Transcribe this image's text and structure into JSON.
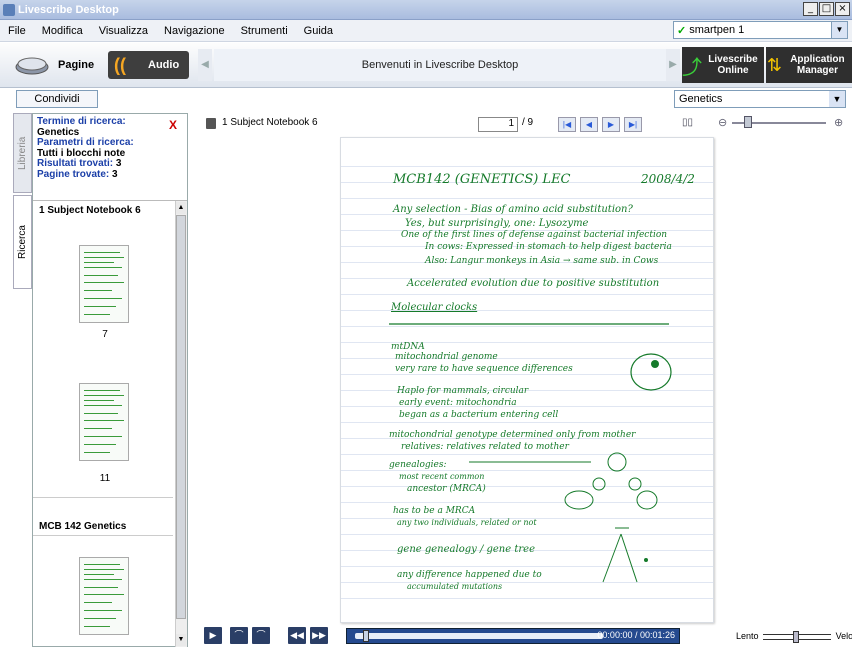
{
  "window": {
    "title": "Livescribe Desktop"
  },
  "menu": {
    "items": [
      "File",
      "Modifica",
      "Visualizza",
      "Navigazione",
      "Strumenti",
      "Guida"
    ]
  },
  "pen": {
    "selected": "smartpen 1"
  },
  "toolbar": {
    "pages_label": "Pagine",
    "audio_label": "Audio",
    "welcome": "Benvenuti in Livescribe Desktop",
    "online_label": "Livescribe Online",
    "appmgr_label": "Application Manager"
  },
  "share_label": "Condividi",
  "notebook_filter": "Genetics",
  "tabs": {
    "library": "Libreria",
    "search": "Ricerca"
  },
  "search": {
    "term_label": "Termine di ricerca:",
    "term_value": "Genetics",
    "params_label": "Parametri di ricerca:",
    "params_value": "Tutti i blocchi note",
    "results_label": "Risultati trovati:",
    "results_value": "3",
    "pages_label": "Pagine trovate:",
    "pages_value": "3"
  },
  "results": [
    {
      "notebook": "1 Subject Notebook 6",
      "page": "7"
    },
    {
      "notebook": "",
      "page": "11"
    },
    {
      "notebook": "MCB 142 Genetics",
      "page": ""
    }
  ],
  "viewer": {
    "notebook_title": "1 Subject Notebook 6",
    "page_current": "1",
    "page_total": "/ 9"
  },
  "note": {
    "header": "MCB142 (GENETICS) LEC",
    "date": "2008/4/2",
    "lines": [
      "Any selection - Bias of amino acid substitution?",
      "Yes, but surprisingly, one: Lysozyme",
      "One of the first lines of defense against bacterial infection",
      "In cows: Expressed in stomach to help digest bacteria",
      "Also: Langur monkeys in Asia → same sub. in Cows",
      "Accelerated evolution due to positive substitution",
      "Molecular clocks",
      "mtDNA",
      "mitochondrial genome",
      "very rare to have sequence differences",
      "Haplo for mammals, circular",
      "early event: mitochondria",
      "began as a bacterium entering cell",
      "mitochondrial genotype determined only from mother",
      "relatives: relatives related to mother",
      "genealogies:",
      "most recent common",
      "ancestor (MRCA)",
      "has to be a MRCA",
      "any two individuals, related or not",
      "gene genealogy / gene tree",
      "any difference happened due to",
      "accumulated mutations"
    ]
  },
  "player": {
    "time": "00:00:00 / 00:01:26",
    "slow": "Lento",
    "fast": "Veloce"
  },
  "colors": {
    "ink": "#157a2a",
    "timeline": "#254a8f",
    "search_label": "#1b3fa8"
  },
  "icons": [
    "pages-icon",
    "audio-icon",
    "livescribe-online-icon",
    "app-manager-icon",
    "close-icon",
    "notebook-icon",
    "zoom-out-icon",
    "zoom-in-icon",
    "play-icon"
  ]
}
